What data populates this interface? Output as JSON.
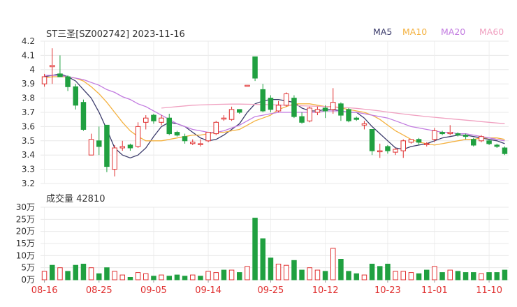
{
  "header": {
    "title": "ST三圣[SZ002742] 2023-11-16",
    "legend": [
      {
        "label": "MA5",
        "color": "#3b3b6b"
      },
      {
        "label": "MA10",
        "color": "#f4b13f"
      },
      {
        "label": "MA20",
        "color": "#c27be0"
      },
      {
        "label": "MA60",
        "color": "#f0a0c0"
      }
    ]
  },
  "volume_panel": {
    "title": "成交量 42810"
  },
  "chart_data": [
    {
      "type": "candlestick",
      "title": "ST三圣[SZ002742] 2023-11-16",
      "ylim": [
        3.2,
        4.2
      ],
      "yticks": [
        "4.2",
        "4.1",
        "4",
        "3.9",
        "3.8",
        "3.7",
        "3.6",
        "3.5",
        "3.4",
        "3.3",
        "3.2"
      ],
      "up_color": "#e03030",
      "down_color": "#20a040",
      "candles": [
        [
          3.9,
          3.95,
          3.88,
          3.97
        ],
        [
          4.02,
          4.03,
          3.9,
          4.15
        ],
        [
          3.97,
          3.95,
          3.95,
          4.1
        ],
        [
          3.95,
          3.88,
          3.85,
          3.96
        ],
        [
          3.88,
          3.75,
          3.72,
          3.9
        ],
        [
          3.77,
          3.58,
          3.57,
          3.79
        ],
        [
          3.4,
          3.51,
          3.4,
          3.55
        ],
        [
          3.5,
          3.46,
          3.4,
          3.6
        ],
        [
          3.61,
          3.32,
          3.28,
          3.61
        ],
        [
          3.3,
          3.45,
          3.25,
          3.47
        ],
        [
          3.45,
          3.46,
          3.43,
          3.5
        ],
        [
          3.47,
          3.45,
          3.43,
          3.48
        ],
        [
          3.46,
          3.6,
          3.45,
          3.63
        ],
        [
          3.63,
          3.66,
          3.58,
          3.68
        ],
        [
          3.68,
          3.64,
          3.62,
          3.69
        ],
        [
          3.63,
          3.66,
          3.61,
          3.68
        ],
        [
          3.66,
          3.55,
          3.54,
          3.69
        ],
        [
          3.56,
          3.54,
          3.53,
          3.57
        ],
        [
          3.53,
          3.5,
          3.48,
          3.55
        ],
        [
          3.48,
          3.49,
          3.47,
          3.51
        ],
        [
          3.48,
          3.48,
          3.46,
          3.51
        ],
        [
          3.5,
          3.56,
          3.49,
          3.56
        ],
        [
          3.55,
          3.63,
          3.54,
          3.64
        ],
        [
          3.66,
          3.66,
          3.64,
          3.68
        ],
        [
          3.65,
          3.72,
          3.64,
          3.74
        ],
        [
          3.72,
          3.7,
          3.69,
          3.72
        ],
        [
          3.89,
          3.89,
          3.89,
          3.89
        ],
        [
          4.09,
          3.94,
          3.92,
          4.09
        ],
        [
          3.86,
          3.71,
          3.7,
          3.9
        ],
        [
          3.8,
          3.72,
          3.7,
          3.82
        ],
        [
          3.71,
          3.75,
          3.7,
          3.78
        ],
        [
          3.75,
          3.83,
          3.74,
          3.84
        ],
        [
          3.8,
          3.67,
          3.66,
          3.82
        ],
        [
          3.67,
          3.63,
          3.62,
          3.7
        ],
        [
          3.64,
          3.73,
          3.63,
          3.74
        ],
        [
          3.7,
          3.72,
          3.68,
          3.74
        ],
        [
          3.73,
          3.71,
          3.66,
          3.75
        ],
        [
          3.72,
          3.77,
          3.69,
          3.87
        ],
        [
          3.76,
          3.68,
          3.64,
          3.77
        ],
        [
          3.72,
          3.64,
          3.63,
          3.73
        ],
        [
          3.66,
          3.65,
          3.64,
          3.67
        ],
        [
          3.61,
          3.62,
          3.58,
          3.64
        ],
        [
          3.58,
          3.43,
          3.4,
          3.58
        ],
        [
          3.43,
          3.43,
          3.38,
          3.48
        ],
        [
          3.46,
          3.43,
          3.41,
          3.47
        ],
        [
          3.42,
          3.44,
          3.4,
          3.45
        ],
        [
          3.43,
          3.5,
          3.38,
          3.51
        ],
        [
          3.49,
          3.51,
          3.48,
          3.51
        ],
        [
          3.51,
          3.49,
          3.47,
          3.52
        ],
        [
          3.48,
          3.48,
          3.46,
          3.49
        ],
        [
          3.51,
          3.57,
          3.49,
          3.59
        ],
        [
          3.56,
          3.55,
          3.54,
          3.57
        ],
        [
          3.55,
          3.56,
          3.54,
          3.61
        ],
        [
          3.55,
          3.54,
          3.53,
          3.56
        ],
        [
          3.54,
          3.53,
          3.51,
          3.55
        ],
        [
          3.51,
          3.47,
          3.46,
          3.52
        ],
        [
          3.5,
          3.53,
          3.49,
          3.54
        ],
        [
          3.5,
          3.48,
          3.47,
          3.51
        ],
        [
          3.47,
          3.46,
          3.45,
          3.48
        ],
        [
          3.45,
          3.41,
          3.4,
          3.46
        ]
      ],
      "ma_series": [
        {
          "name": "MA5",
          "color": "#3b3b6b",
          "values": [
            3.95,
            3.96,
            3.97,
            3.95,
            3.92,
            3.86,
            3.8,
            3.7,
            3.58,
            3.45,
            3.4,
            3.38,
            3.4,
            3.45,
            3.53,
            3.6,
            3.63,
            3.62,
            3.6,
            3.56,
            3.52,
            3.5,
            3.51,
            3.54,
            3.58,
            3.62,
            3.7,
            3.76,
            3.78,
            3.79,
            3.79,
            3.78,
            3.77,
            3.73,
            3.71,
            3.71,
            3.72,
            3.72,
            3.71,
            3.7,
            3.7,
            3.66,
            3.6,
            3.55,
            3.5,
            3.45,
            3.44,
            3.46,
            3.47,
            3.48,
            3.5,
            3.52,
            3.53,
            3.54,
            3.54,
            3.53,
            3.52,
            3.51,
            3.5,
            3.48
          ]
        },
        {
          "name": "MA10",
          "color": "#f4b13f",
          "values": [
            3.94,
            3.95,
            3.95,
            3.95,
            3.94,
            3.92,
            3.88,
            3.83,
            3.77,
            3.7,
            3.63,
            3.57,
            3.53,
            3.5,
            3.5,
            3.5,
            3.51,
            3.52,
            3.53,
            3.54,
            3.54,
            3.55,
            3.56,
            3.56,
            3.57,
            3.58,
            3.61,
            3.64,
            3.66,
            3.68,
            3.72,
            3.74,
            3.76,
            3.76,
            3.76,
            3.75,
            3.74,
            3.74,
            3.73,
            3.72,
            3.71,
            3.7,
            3.68,
            3.65,
            3.61,
            3.57,
            3.54,
            3.51,
            3.49,
            3.48,
            3.47,
            3.48,
            3.49,
            3.5,
            3.51,
            3.51,
            3.52,
            3.52,
            3.52,
            3.51
          ]
        },
        {
          "name": "MA20",
          "color": "#c27be0",
          "values": [
            3.96,
            3.96,
            3.96,
            3.95,
            3.94,
            3.93,
            3.91,
            3.89,
            3.86,
            3.84,
            3.81,
            3.79,
            3.76,
            3.74,
            3.71,
            3.68,
            3.65,
            3.62,
            3.6,
            3.58,
            3.57,
            3.56,
            3.56,
            3.57,
            3.59,
            3.61,
            3.64,
            3.67,
            3.68,
            3.69,
            3.7,
            3.7,
            3.7,
            3.7,
            3.7,
            3.7,
            3.71,
            3.71,
            3.71,
            3.7,
            3.7,
            3.69,
            3.68,
            3.67,
            3.66,
            3.64,
            3.62,
            3.6,
            3.59,
            3.58,
            3.57,
            3.56,
            3.56,
            3.55,
            3.55,
            3.54,
            3.53,
            3.52,
            3.51,
            3.5
          ]
        },
        {
          "name": "MA60",
          "color": "#f0a0c0",
          "values": [
            null,
            null,
            null,
            null,
            null,
            null,
            null,
            null,
            null,
            null,
            null,
            null,
            null,
            null,
            null,
            3.73,
            3.735,
            3.74,
            3.745,
            3.75,
            3.752,
            3.754,
            3.756,
            3.757,
            3.758,
            3.758,
            3.757,
            3.756,
            3.755,
            3.754,
            3.752,
            3.75,
            3.748,
            3.746,
            3.744,
            3.742,
            3.74,
            3.738,
            3.735,
            3.732,
            3.728,
            3.722,
            3.716,
            3.71,
            3.702,
            3.695,
            3.688,
            3.682,
            3.676,
            3.67,
            3.665,
            3.66,
            3.655,
            3.65,
            3.645,
            3.64,
            3.635,
            3.63,
            3.625,
            3.62
          ]
        }
      ]
    },
    {
      "type": "bar",
      "title": "成交量 42810",
      "ylim": [
        0,
        30
      ],
      "yticks": [
        "30万",
        "25万",
        "20万",
        "15万",
        "10万",
        "5万",
        "0万"
      ],
      "x_labels": [
        "08-16",
        "08-25",
        "09-05",
        "09-14",
        "09-25",
        "10-12",
        "10-23",
        "11-01",
        "11-10"
      ],
      "values": [
        3.5,
        6.0,
        5.0,
        3.5,
        6.0,
        6.5,
        5.0,
        2.5,
        5.0,
        3.5,
        2.0,
        1.0,
        3.0,
        2.5,
        1.5,
        2.0,
        1.5,
        2.0,
        1.5,
        2.0,
        1.5,
        3.5,
        3.0,
        4.0,
        4.0,
        3.0,
        5.5,
        25.5,
        17.0,
        9.0,
        6.5,
        6.0,
        8.0,
        4.0,
        5.0,
        4.0,
        3.5,
        13.0,
        8.5,
        3.5,
        2.5,
        2.0,
        6.5,
        5.5,
        6.5,
        3.5,
        3.5,
        3.0,
        2.5,
        4.0,
        5.5,
        3.0,
        4.0,
        3.5,
        3.0,
        3.0,
        2.5,
        3.0,
        3.0,
        4.0
      ],
      "colors": [
        "up",
        "down",
        "up",
        "down",
        "down",
        "down",
        "up",
        "down",
        "down",
        "up",
        "up",
        "down",
        "up",
        "up",
        "down",
        "up",
        "down",
        "down",
        "down",
        "up",
        "down",
        "up",
        "up",
        "down",
        "up",
        "down",
        "up",
        "down",
        "down",
        "down",
        "up",
        "up",
        "down",
        "down",
        "up",
        "up",
        "down",
        "up",
        "down",
        "down",
        "down",
        "up",
        "down",
        "down",
        "down",
        "up",
        "up",
        "up",
        "down",
        "down",
        "up",
        "down",
        "up",
        "down",
        "down",
        "down",
        "up",
        "down",
        "down",
        "down"
      ]
    }
  ]
}
